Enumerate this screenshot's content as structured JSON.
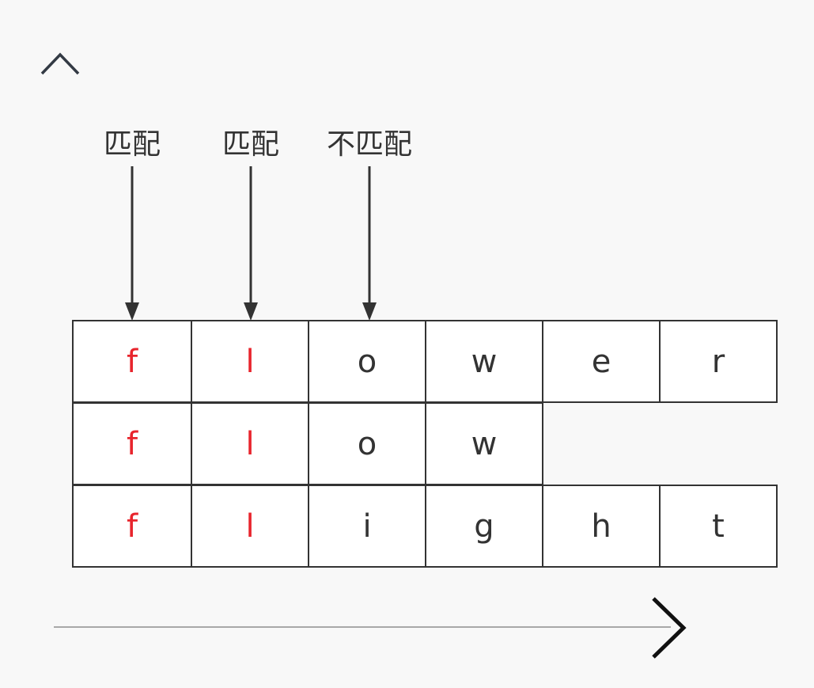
{
  "toolbar": {
    "collapse_icon": "chevron-up-icon",
    "next_icon": "chevron-right-icon"
  },
  "labels": [
    {
      "text": "匹配"
    },
    {
      "text": "匹配"
    },
    {
      "text": "不匹配"
    }
  ],
  "grid": {
    "rows": [
      {
        "cells": [
          "f",
          "l",
          "o",
          "w",
          "e",
          "r"
        ]
      },
      {
        "cells": [
          "f",
          "l",
          "o",
          "w",
          "",
          ""
        ]
      },
      {
        "cells": [
          "f",
          "l",
          "i",
          "g",
          "h",
          "t"
        ]
      }
    ],
    "matched_columns": 2
  },
  "colors": {
    "matched_text": "#e8252d",
    "text": "#333333",
    "border": "#333333",
    "background": "#f8f8f8"
  }
}
